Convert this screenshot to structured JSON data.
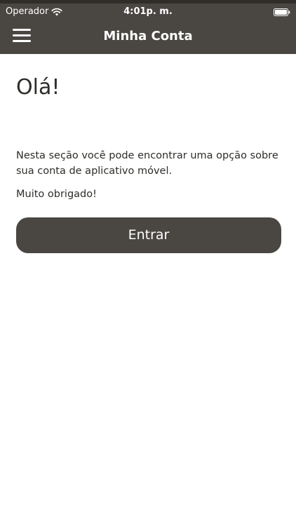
{
  "status_bar": {
    "carrier": "Operador",
    "time": "4:01p. m."
  },
  "nav": {
    "title": "Minha Conta",
    "menu_icon": "hamburger-menu-icon"
  },
  "main": {
    "greeting": "Olá!",
    "description": "Nesta seção você pode encontrar uma opção sobre sua conta de aplicativo móvel.",
    "thanks": "Muito obrigado!",
    "login_button": "Entrar"
  },
  "colors": {
    "bar_background": "#4a4743",
    "button_background": "#4a4743",
    "text": "#2f2d2a",
    "background": "#ffffff"
  }
}
